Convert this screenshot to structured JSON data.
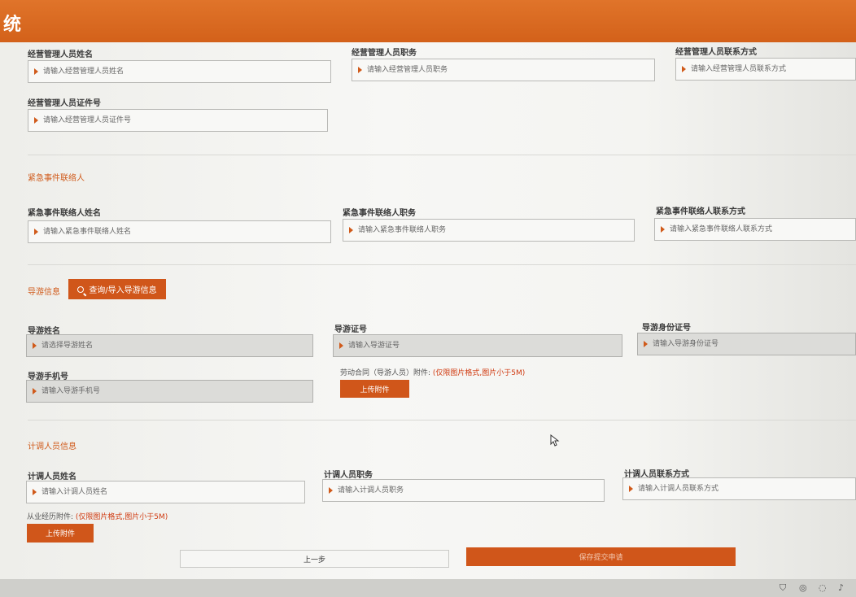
{
  "header": {
    "title": "统"
  },
  "manager": {
    "name": {
      "label": "经营管理人员姓名",
      "placeholder": "请输入经营管理人员姓名"
    },
    "position": {
      "label": "经营管理人员职务",
      "placeholder": "请输入经营管理人员职务"
    },
    "contact": {
      "label": "经营管理人员联系方式",
      "placeholder": "请输入经营管理人员联系方式"
    },
    "id_number": {
      "label": "经营管理人员证件号",
      "placeholder": "请输入经营管理人员证件号"
    }
  },
  "emergency": {
    "section_title": "紧急事件联络人",
    "name": {
      "label": "紧急事件联络人姓名",
      "placeholder": "请输入紧急事件联络人姓名"
    },
    "position": {
      "label": "紧急事件联络人职务",
      "placeholder": "请输入紧急事件联络人职务"
    },
    "contact": {
      "label": "紧急事件联络人联系方式",
      "placeholder": "请输入紧急事件联络人联系方式"
    }
  },
  "guide": {
    "section_title": "导游信息",
    "search_button": "查询/导入导游信息",
    "name": {
      "label": "导游姓名",
      "placeholder": "请选择导游姓名"
    },
    "license": {
      "label": "导游证号",
      "placeholder": "请输入导游证号"
    },
    "id_card": {
      "label": "导游身份证号",
      "placeholder": "请输入导游身份证号"
    },
    "phone": {
      "label": "导游手机号",
      "placeholder": "请输入导游手机号"
    },
    "attachment_note": "劳动合同（导游人员）附件:",
    "attachment_warn": "(仅限图片格式,图片小于5M)",
    "upload_button": "上传附件"
  },
  "planner": {
    "section_title": "计调人员信息",
    "name": {
      "label": "计调人员姓名",
      "placeholder": "请输入计调人员姓名"
    },
    "position": {
      "label": "计调人员职务",
      "placeholder": "请输入计调人员职务"
    },
    "contact": {
      "label": "计调人员联系方式",
      "placeholder": "请输入计调人员联系方式"
    },
    "attachment_note": "从业经历附件:",
    "attachment_warn": "(仅限图片格式,图片小于5M)",
    "upload_button": "上传附件"
  },
  "actions": {
    "prev": "上一步",
    "submit": "保存提交申请"
  },
  "colors": {
    "accent": "#d0561a",
    "header": "#da6a22"
  }
}
